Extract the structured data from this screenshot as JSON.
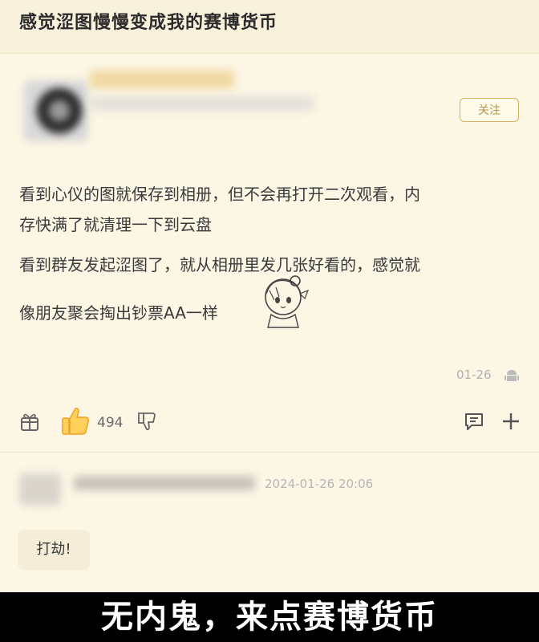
{
  "post": {
    "title": "感觉涩图慢慢变成我的赛博货币",
    "follow_label": "关注",
    "body_lines": [
      "看到心仪的图就保存到相册，但不会再打开二次观看，内",
      "存快满了就清理一下到云盘",
      "看到群友发起涩图了，就从相册里发几张好看的，感觉就",
      "像朋友聚会掏出钞票AA一样"
    ],
    "date": "01-26",
    "like_count": "494"
  },
  "comment": {
    "timestamp": "2024-01-26 20:06",
    "text": "打劫!"
  },
  "subtitle": "无内鬼，来点赛博货币",
  "colors": {
    "background": "#fcf6e4",
    "accent": "#d5b45c",
    "banner": "#000000"
  },
  "icons": [
    "gift-icon",
    "thumbs-up-icon",
    "thumbs-down-icon",
    "comment-icon",
    "plus-icon",
    "android-icon"
  ]
}
